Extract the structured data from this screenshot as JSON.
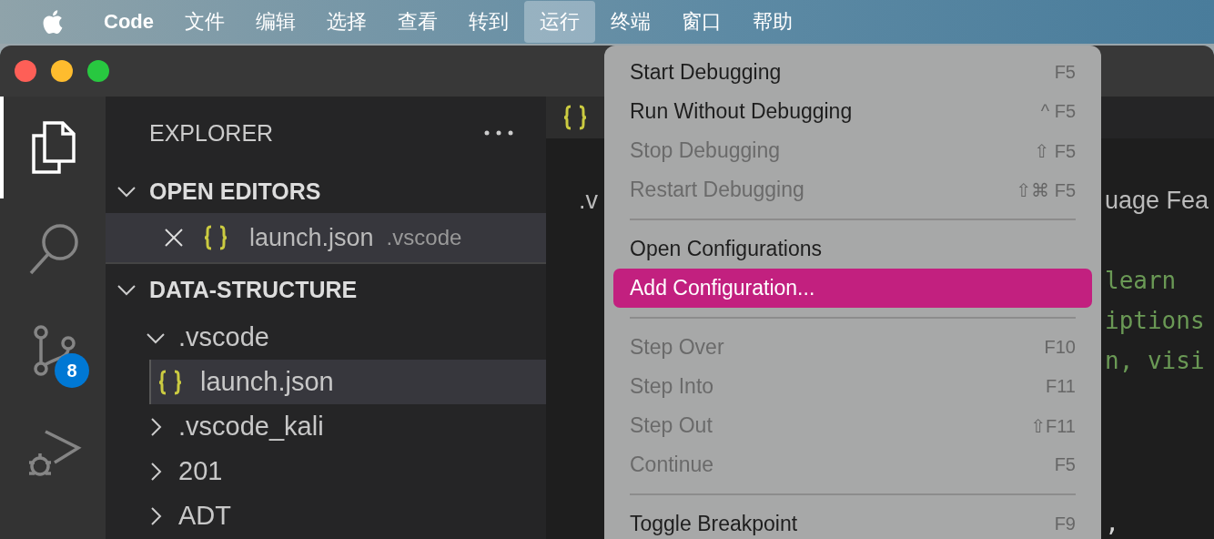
{
  "menubar": {
    "items": [
      {
        "label": "Code",
        "kind": "app",
        "selected": false
      },
      {
        "label": "文件",
        "kind": "menu",
        "selected": false
      },
      {
        "label": "编辑",
        "kind": "menu",
        "selected": false
      },
      {
        "label": "选择",
        "kind": "menu",
        "selected": false
      },
      {
        "label": "查看",
        "kind": "menu",
        "selected": false
      },
      {
        "label": "转到",
        "kind": "menu",
        "selected": false
      },
      {
        "label": "运行",
        "kind": "menu",
        "selected": true
      },
      {
        "label": "终端",
        "kind": "menu",
        "selected": false
      },
      {
        "label": "窗口",
        "kind": "menu",
        "selected": false
      },
      {
        "label": "帮助",
        "kind": "menu",
        "selected": false
      }
    ]
  },
  "activity_bar": {
    "items": [
      {
        "kind": "files",
        "selected": true
      },
      {
        "kind": "search",
        "selected": false
      },
      {
        "kind": "source-control",
        "selected": false,
        "badge": "8"
      },
      {
        "kind": "debug",
        "selected": false
      }
    ]
  },
  "sidebar": {
    "title": "EXPLORER",
    "open_editors": {
      "title": "OPEN EDITORS",
      "expanded": true,
      "items": [
        {
          "name": "launch.json",
          "folder": ".vscode",
          "selected": true
        }
      ]
    },
    "folder": {
      "title": "DATA-STRUCTURE",
      "expanded": true,
      "children": [
        {
          "name": ".vscode",
          "kind": "folder",
          "expanded": true,
          "children": [
            {
              "name": "launch.json",
              "kind": "json",
              "selected": true
            }
          ]
        },
        {
          "name": ".vscode_kali",
          "kind": "folder",
          "expanded": false
        },
        {
          "name": "201",
          "kind": "folder",
          "expanded": false
        },
        {
          "name": "ADT",
          "kind": "folder",
          "expanded": false
        }
      ]
    }
  },
  "editor": {
    "left_lines": [
      {
        "kind": "blank"
      },
      {
        "kind": "plain",
        "text": ".v"
      }
    ],
    "right_lines": [
      {
        "kind": "blank"
      },
      {
        "kind": "plain",
        "text": "uage Fea"
      },
      {
        "kind": "blank"
      },
      {
        "kind": "comment",
        "text": "learn"
      },
      {
        "kind": "comment",
        "text": "iptions"
      },
      {
        "kind": "comment",
        "text": "n, visi"
      },
      {
        "kind": "blank"
      },
      {
        "kind": "blank"
      },
      {
        "kind": "blank"
      },
      {
        "kind": "code",
        "text": ","
      }
    ]
  },
  "run_menu": {
    "items": [
      {
        "kind": "item",
        "label": "Start Debugging",
        "shortcut": "F5",
        "disabled": false,
        "selected": false
      },
      {
        "kind": "item",
        "label": "Run Without Debugging",
        "shortcut": "^ F5",
        "disabled": false,
        "selected": false
      },
      {
        "kind": "item",
        "label": "Stop Debugging",
        "shortcut": "⇧ F5",
        "disabled": true,
        "selected": false
      },
      {
        "kind": "item",
        "label": "Restart Debugging",
        "shortcut": "⇧⌘ F5",
        "disabled": true,
        "selected": false
      },
      {
        "kind": "separator"
      },
      {
        "kind": "item",
        "label": "Open Configurations",
        "disabled": false,
        "selected": false
      },
      {
        "kind": "item",
        "label": "Add Configuration...",
        "disabled": false,
        "selected": true
      },
      {
        "kind": "separator"
      },
      {
        "kind": "item",
        "label": "Step Over",
        "shortcut": "F10",
        "disabled": true,
        "selected": false
      },
      {
        "kind": "item",
        "label": "Step Into",
        "shortcut": "F11",
        "disabled": true,
        "selected": false
      },
      {
        "kind": "item",
        "label": "Step Out",
        "shortcut": "⇧F11",
        "disabled": true,
        "selected": false
      },
      {
        "kind": "item",
        "label": "Continue",
        "shortcut": "F5",
        "disabled": true,
        "selected": false
      },
      {
        "kind": "separator"
      },
      {
        "kind": "item",
        "label": "Toggle Breakpoint",
        "shortcut": "F9",
        "disabled": false,
        "selected": false
      }
    ]
  }
}
